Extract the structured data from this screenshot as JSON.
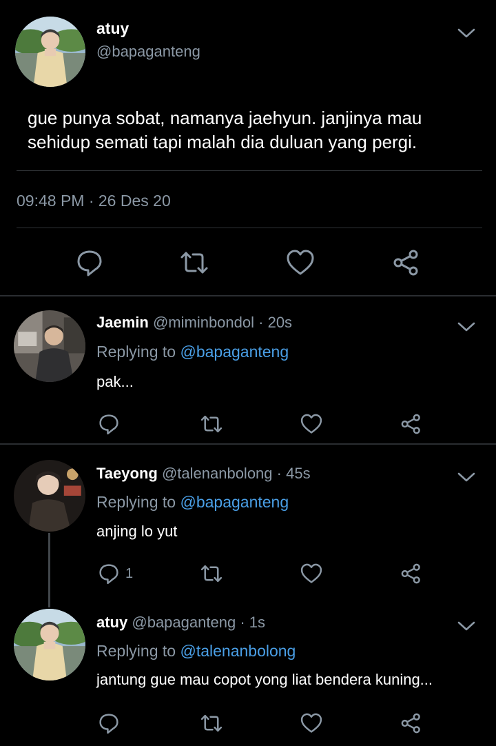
{
  "main_tweet": {
    "name": "atuy",
    "handle": "@bapaganteng",
    "text": "gue punya sobat, namanya jaehyun. janjinya mau sehidup semati tapi malah dia duluan yang pergi.",
    "timestamp": "09:48 PM · 26 Des 20",
    "avatar_icon": "avatar-photo-icon",
    "actions": [
      "reply-icon",
      "retweet-icon",
      "like-icon",
      "share-icon"
    ]
  },
  "replies": [
    {
      "name": "Jaemin",
      "handle": "@miminbondol",
      "time": "· 20s",
      "replying_prefix": "Replying to",
      "replying_to": "@bapaganteng",
      "text": "pak...",
      "reply_count": ""
    },
    {
      "name": "Taeyong",
      "handle": "@talenanbolong",
      "time": "· 45s",
      "replying_prefix": "Replying to",
      "replying_to": "@bapaganteng",
      "text": "anjing lo yut",
      "reply_count": "1"
    },
    {
      "name": "atuy",
      "handle": "@bapaganteng",
      "time": "· 1s",
      "replying_prefix": "Replying to",
      "replying_to": "@talenanbolong",
      "text": "jantung gue mau copot yong liat bendera kuning...",
      "reply_count": ""
    }
  ],
  "colors": {
    "background": "#000000",
    "secondary_text": "#8b98a5",
    "link": "#4a9fe6",
    "divider": "#2f3336"
  }
}
